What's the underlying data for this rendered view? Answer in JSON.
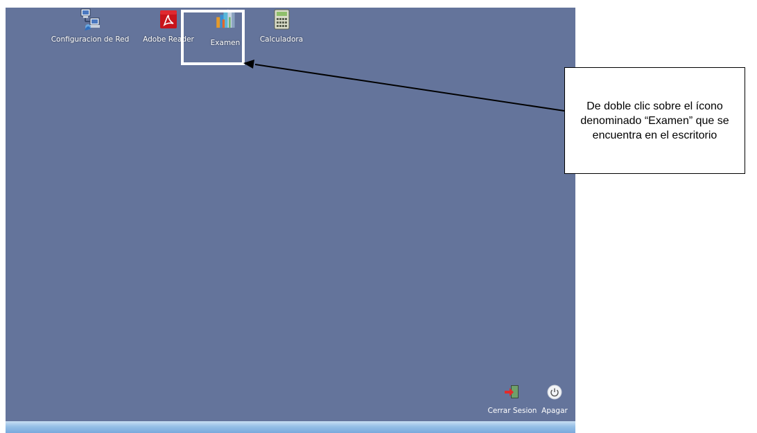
{
  "desktop": {
    "background": "#64749b",
    "icons": [
      {
        "label": "Configuracion de Red",
        "icon": "network-config-icon"
      },
      {
        "label": "Adobe Reader",
        "icon": "adobe-reader-icon"
      },
      {
        "label": "Examen",
        "icon": "exam-books-icon"
      },
      {
        "label": "Calculadora",
        "icon": "calculator-icon"
      }
    ],
    "session": {
      "logout_label": "Cerrar Sesion",
      "shutdown_label": "Apagar"
    }
  },
  "annotation": {
    "callout_text": "De doble clic sobre el ícono denominado “Examen” que se encuentra en el escritorio",
    "highlight_color": "#ffffff",
    "arrow_color": "#000000"
  },
  "taskbar": {
    "color": "#8fb8e3"
  }
}
